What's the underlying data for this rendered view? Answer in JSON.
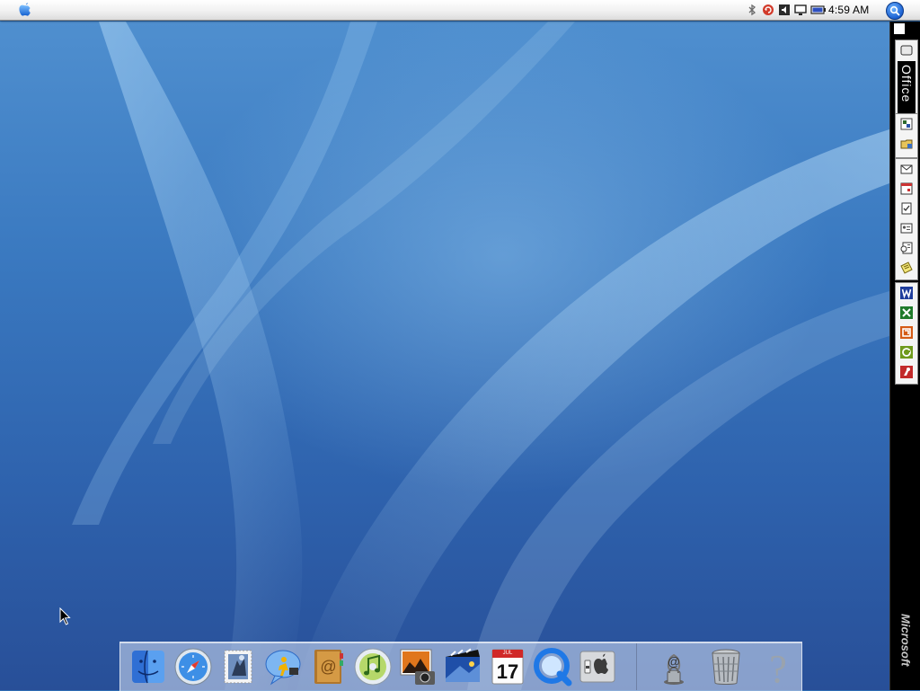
{
  "menubar": {
    "apple_menu_icon": "apple-logo-icon",
    "clock": "4:59 AM",
    "extras": [
      "bluetooth-icon",
      "sync-icon",
      "volume-icon",
      "display-icon",
      "battery-icon"
    ],
    "spotlight_icon": "spotlight-search-icon"
  },
  "office_toolbar": {
    "title": "Office",
    "brand": "Microsoft",
    "groups": [
      [
        "project-gallery-icon",
        "office-open-icon"
      ],
      [
        "mail-icon",
        "calendar-icon",
        "tasks-icon",
        "contacts-icon",
        "address-book-icon",
        "notes-icon"
      ],
      [
        "word-icon",
        "excel-icon",
        "powerpoint-icon",
        "entourage-icon",
        "messenger-icon"
      ]
    ]
  },
  "dock": {
    "apps": [
      {
        "name": "Finder",
        "icon": "finder-icon"
      },
      {
        "name": "Safari",
        "icon": "safari-icon"
      },
      {
        "name": "Mail",
        "icon": "mail-stamp-icon"
      },
      {
        "name": "iChat",
        "icon": "ichat-icon"
      },
      {
        "name": "Address Book",
        "icon": "address-book-icon"
      },
      {
        "name": "iTunes",
        "icon": "itunes-icon"
      },
      {
        "name": "iPhoto",
        "icon": "iphoto-icon"
      },
      {
        "name": "iMovie",
        "icon": "imovie-icon"
      },
      {
        "name": "iCal",
        "icon": "ical-icon"
      },
      {
        "name": "QuickTime Player",
        "icon": "quicktime-icon"
      },
      {
        "name": "System Preferences",
        "icon": "system-preferences-icon"
      }
    ],
    "others": [
      {
        "name": "Internet Connect",
        "icon": "internet-connect-icon"
      },
      {
        "name": "Trash",
        "icon": "trash-icon"
      },
      {
        "name": "Help",
        "icon": "help-icon"
      }
    ],
    "ical_month": "JUL",
    "ical_day": "17"
  },
  "colors": {
    "menubar": "#f1f1f1",
    "wallpaper": "#2f6db3",
    "office_bar": "#000000"
  }
}
